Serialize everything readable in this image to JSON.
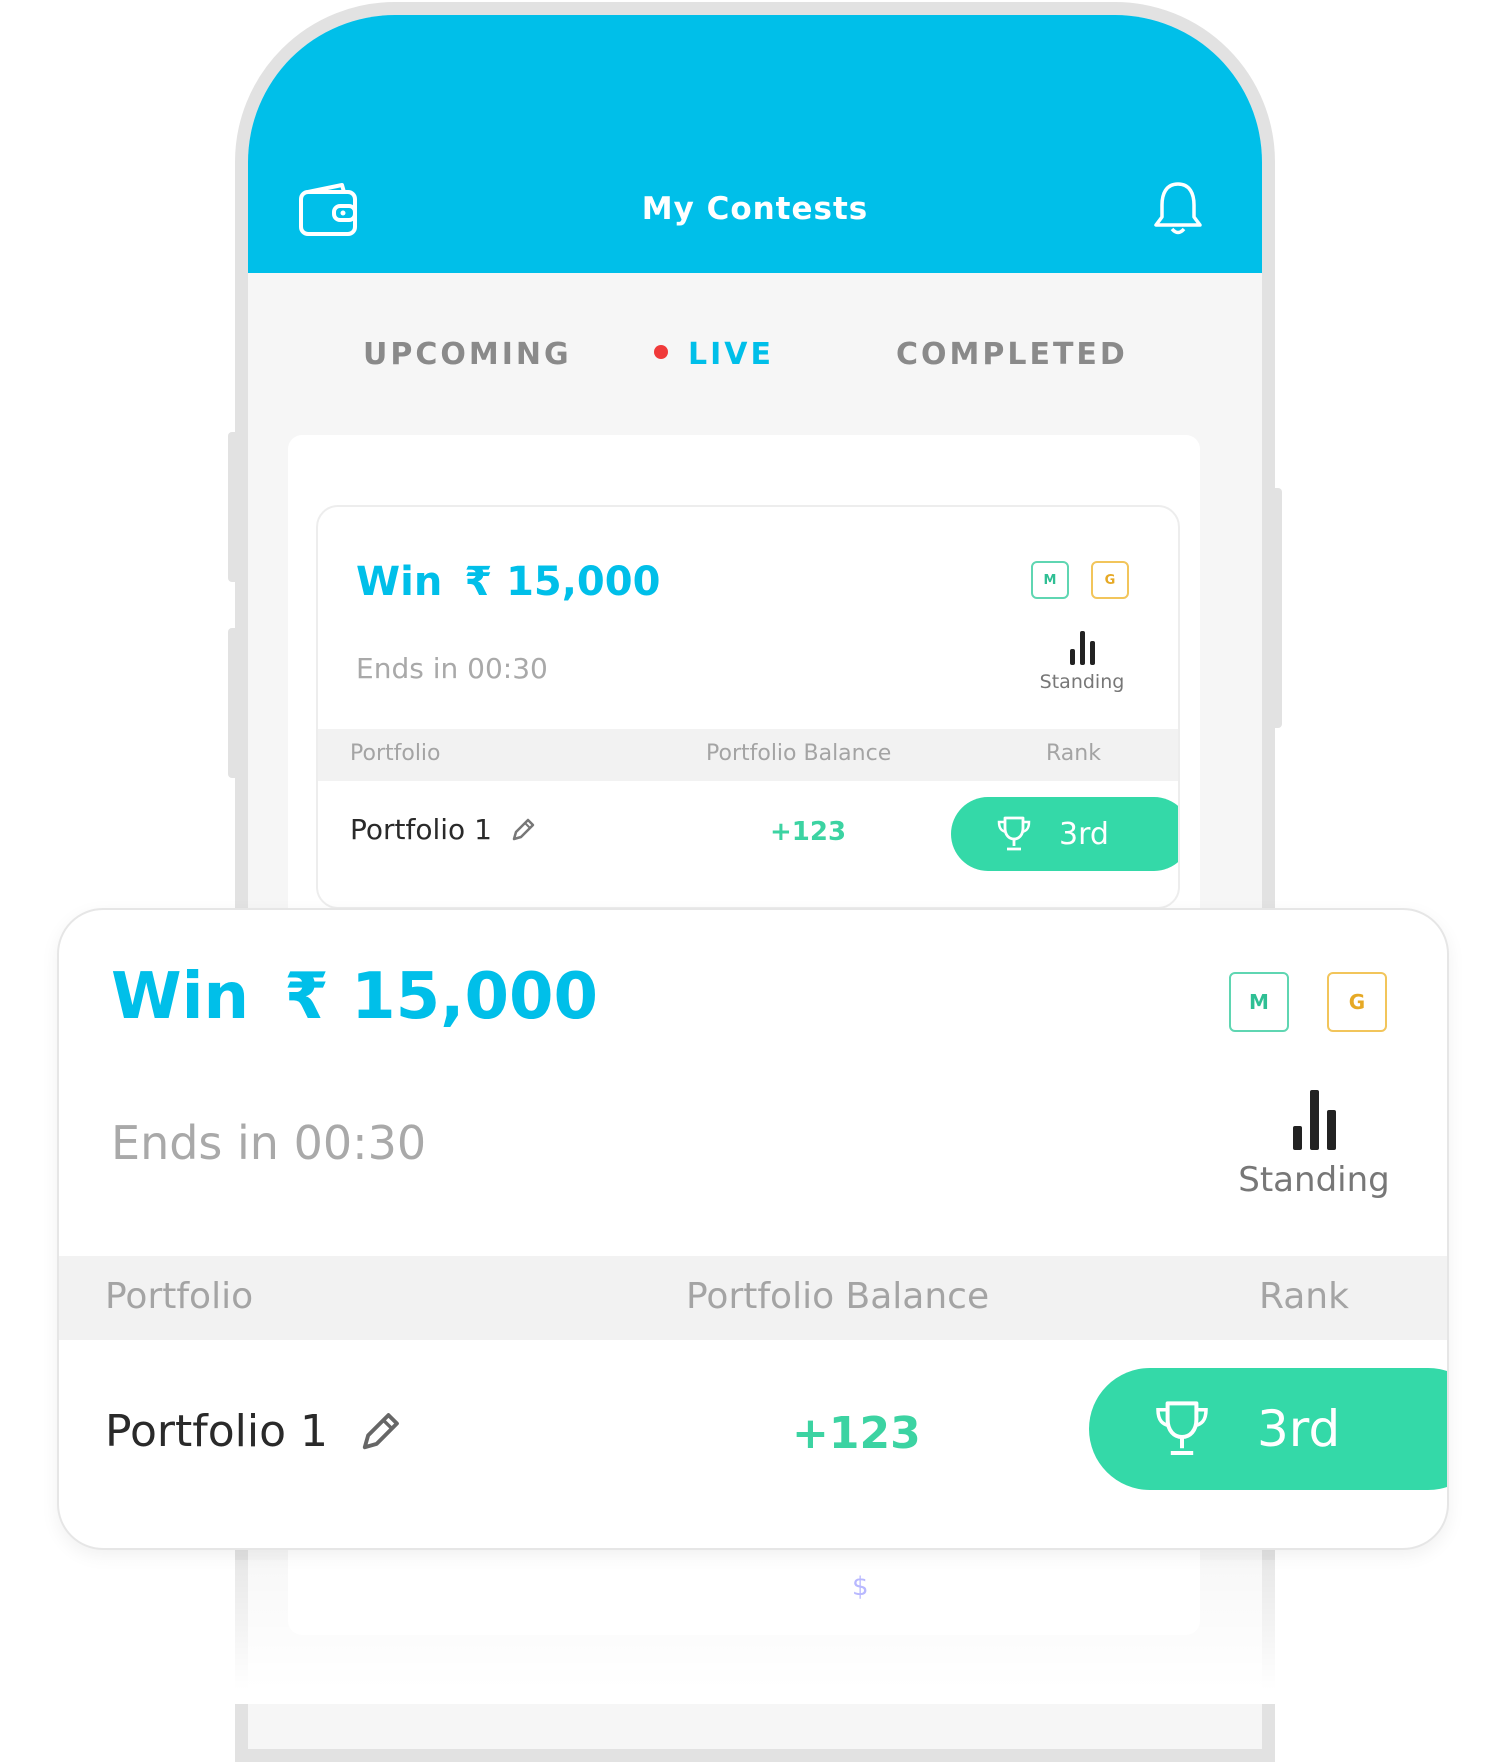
{
  "header": {
    "title": "My Contests"
  },
  "tabs": [
    {
      "label": "UPCOMING"
    },
    {
      "label": "LIVE"
    },
    {
      "label": "COMPLETED"
    }
  ],
  "contest": {
    "prize_label": "Win",
    "prize_amount": "₹ 15,000",
    "ends_text": "Ends in 00:30",
    "badges": {
      "m": "M",
      "g": "G"
    },
    "standing_label": "Standing",
    "columns": {
      "portfolio": "Portfolio",
      "balance": "Portfolio Balance",
      "rank": "Rank"
    },
    "row": {
      "portfolio": "Portfolio 1",
      "balance": "+123",
      "rank": "3rd"
    }
  },
  "footer_glyph": "$",
  "colors": {
    "brand": "#00bfe9",
    "rank_pill": "#34d9a8",
    "balance": "#3cd3a2",
    "live_dot": "#f03a3a"
  },
  "icons": [
    "wallet-icon",
    "bell-icon",
    "standing-icon",
    "pencil-icon",
    "trophy-icon"
  ]
}
